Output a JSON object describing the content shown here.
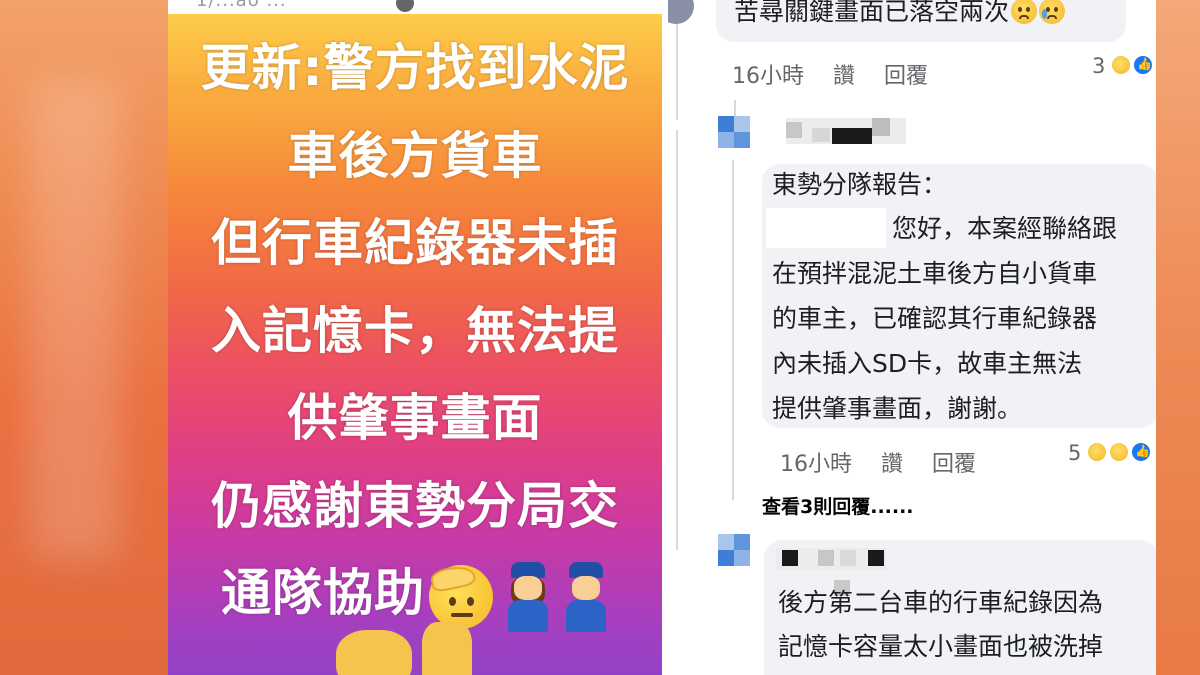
{
  "story": {
    "header_text": "1/...ao ...",
    "lines": [
      "更新:警方找到水泥",
      "車後方貨車",
      "但行車紀錄器未插",
      "入記憶卡，無法提",
      "供肇事畫面",
      "仍感謝東勢分局交",
      "通隊協助"
    ],
    "emojis": [
      "saluting-face",
      "woman-police-officer",
      "police-officer",
      "handshake",
      "thumbs-up"
    ]
  },
  "comments": {
    "top_comment": {
      "text": "苦尋關鍵畫面已落空兩次",
      "emojis": [
        "sad-face",
        "crying-face"
      ],
      "time": "16小時",
      "like_label": "讚",
      "reply_label": "回覆",
      "reaction_count": "3",
      "reactions": [
        "sad",
        "like"
      ]
    },
    "reply_comment": {
      "lines": [
        "東勢分隊報告：",
        "您好，本案經聯絡跟",
        "在預拌混泥土車後方自小貨車",
        "的車主，已確認其行車紀錄器",
        "內未插入SD卡，故車主無法",
        "提供肇事畫面，謝謝。"
      ],
      "time": "16小時",
      "like_label": "讚",
      "reply_label": "回覆",
      "reaction_count": "5",
      "reactions": [
        "wow",
        "sad",
        "like"
      ]
    },
    "view_replies_label": "查看3則回覆......",
    "third_comment": {
      "lines": [
        "後方第二台車的行車紀錄因為",
        "記憶卡容量太小畫面也被洗掉"
      ]
    },
    "colors": {
      "bubble_bg": "#f0f2f5",
      "meta_text": "#65676b",
      "like_blue": "#1877f2"
    }
  }
}
